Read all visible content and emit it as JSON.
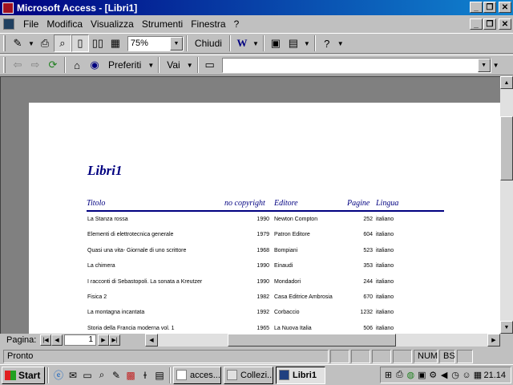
{
  "window": {
    "title": "Microsoft Access - [Libri1]"
  },
  "menubar": {
    "items": [
      "File",
      "Modifica",
      "Visualizza",
      "Strumenti",
      "Finestra",
      "?"
    ]
  },
  "toolbar": {
    "zoom": "75%",
    "close_label": "Chiudi"
  },
  "webbar": {
    "favorites_label": "Preferiti",
    "go_label": "Vai",
    "address_value": ""
  },
  "report": {
    "title": "Libri1",
    "headers": {
      "title": "Titolo",
      "copyright": "no copyright",
      "publisher": "Editore",
      "pages": "Pagine",
      "language": "Lingua"
    },
    "rows": [
      {
        "title": "La Stanza rossa",
        "year": "1990",
        "publisher": "Newton Compton",
        "pages": "252",
        "language": "italiano"
      },
      {
        "title": "Elementi di elettrotecnica generale",
        "year": "1979",
        "publisher": "Patron Editore",
        "pages": "604",
        "language": "italiano"
      },
      {
        "title": "Quasi una vita- Giornale di uno scrittore",
        "year": "1968",
        "publisher": "Bompiani",
        "pages": "523",
        "language": "italiano"
      },
      {
        "title": "La chimera",
        "year": "1990",
        "publisher": "Einaudi",
        "pages": "353",
        "language": "italiano"
      },
      {
        "title": "I racconti di Sebastopoli. La sonata a Kreutzer",
        "year": "1990",
        "publisher": "Mondadori",
        "pages": "244",
        "language": "italiano"
      },
      {
        "title": "Fisica 2",
        "year": "1982",
        "publisher": "Casa Editrice Ambrosia",
        "pages": "670",
        "language": "italiano"
      },
      {
        "title": "La montagna incantata",
        "year": "1992",
        "publisher": "Corbaccio",
        "pages": "1232",
        "language": "italiano"
      },
      {
        "title": "Storia della Francia moderna vol. 1",
        "year": "1965",
        "publisher": "La Nuova Italia",
        "pages": "506",
        "language": "italiano"
      }
    ]
  },
  "navigation": {
    "page_label": "Pagina:",
    "page_value": "1"
  },
  "statusbar": {
    "text": "Pronto",
    "num": "NUM",
    "bs": "BS"
  },
  "taskbar": {
    "start_label": "Start",
    "tasks": [
      "acces...",
      "Collezi...",
      "Libri1"
    ],
    "clock": "21.14"
  }
}
